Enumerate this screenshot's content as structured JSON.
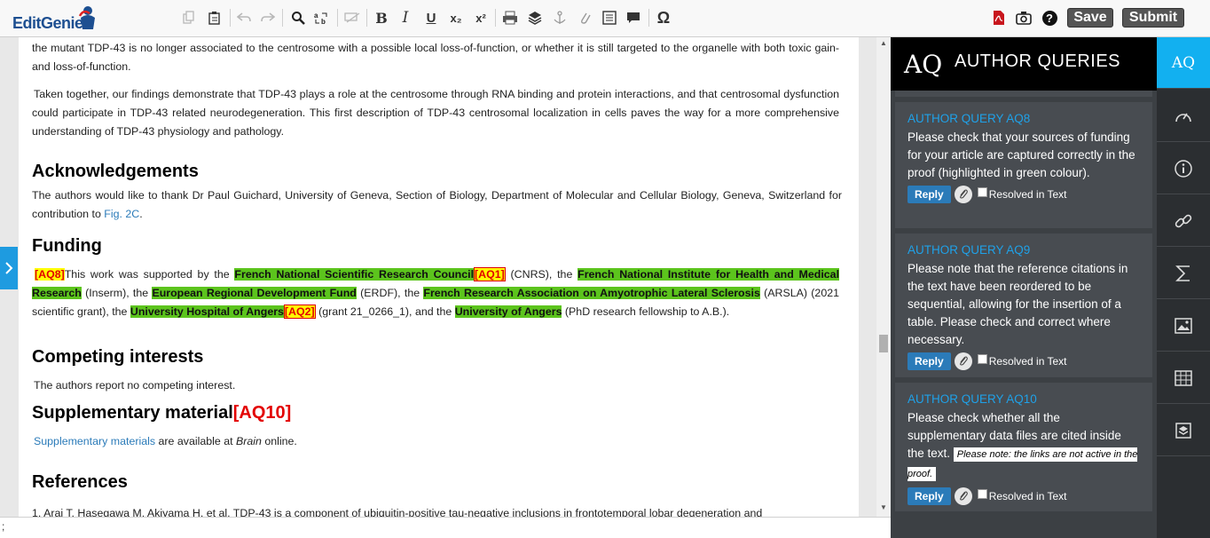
{
  "app": {
    "logo_text": "EditGenie"
  },
  "toolbar": {
    "tools": [
      "copy-icon",
      "paste-icon",
      "undo-icon",
      "redo-icon",
      "search-icon",
      "replace-icon",
      "track-changes-icon",
      "bold-icon",
      "italic-icon",
      "underline-icon",
      "subscript-icon",
      "superscript-icon",
      "print-icon",
      "layers-icon",
      "anchor-icon",
      "link-icon",
      "form-icon",
      "comment-icon",
      "omega-icon"
    ],
    "bold_label": "B",
    "italic_label": "I",
    "underline_label": "U",
    "subscript_label": "x₂",
    "superscript_label": "x²",
    "omega_label": "Ω",
    "save_label": "Save",
    "submit_label": "Submit",
    "help_label": "?"
  },
  "document": {
    "p1": "the mutant TDP-43 is no longer associated to the centrosome with a possible local loss-of-function, or whether it is still targeted to the organelle with both toxic gain- and loss-of-function.",
    "p2": "Taken together, our findings demonstrate that TDP-43 plays a role at the centrosome through RNA binding and protein interactions, and that centrosomal dysfunction could participate in TDP-43 related neurodegeneration. This first description of TDP-43 centrosomal localization in cells paves the way for a more comprehensive understanding of TDP-43 physiology and pathology.",
    "h_ack": "Acknowledgements",
    "ack_text": "The authors would like to thank Dr Paul Guichard, University of Geneva, Section of Biology, Department of Molecular and Cellular Biology, Geneva, Switzerland for contribution to ",
    "ack_link": "Fig. 2C",
    "ack_end": ".",
    "h_funding": "Funding",
    "funding": {
      "aq8": "[AQ8]",
      "t1": "This work was supported by the ",
      "f1": "French National Scientific Research Council",
      "aq1": "[AQ1]",
      "t2": " (CNRS), the ",
      "f2": "French National Institute for Health and Medical Research",
      "t3": " (Inserm), the ",
      "f3": "European Regional Development Fund",
      "t4": " (ERDF), the ",
      "f4": "French Research Association on Amyotrophic Lateral Sclerosis",
      "t5": " (ARSLA) (2021 scientific grant), the ",
      "f5": "University Hospital of Angers",
      "aq2": "[AQ2]",
      "t6": " (grant 21_0266_1), and the ",
      "f6": "University of Angers",
      "t7": " (PhD research fellowship to A.B.)."
    },
    "h_competing": "Competing interests",
    "competing_text": "The authors report no competing interest.",
    "h_supp": "Supplementary material",
    "supp_aq": "[AQ10]",
    "supp_link": "Supplementary materials",
    "supp_text1": " are available at ",
    "supp_journal": "Brain",
    "supp_text2": " online.",
    "h_refs": "References",
    "ref1": "1. Arai T, Hasegawa M, Akiyama H, et al. TDP-43 is a component of ubiquitin-positive tau-negative inclusions in frontotemporal lobar degeneration and",
    "bottom_text": ";"
  },
  "aq_panel": {
    "logo": "AQ",
    "title": "AUTHOR QUERIES",
    "reply_label": "Reply",
    "resolved_label": "Resolved in Text",
    "queries": [
      {
        "title": "AUTHOR QUERY  AQ8",
        "body": "Please check that your sources of funding for your article are captured correctly in the proof (highlighted in green colour)."
      },
      {
        "title": "AUTHOR QUERY  AQ9",
        "body": "Please note that the reference citations in the text have been reordered to be sequential, allowing for the insertion of a table. Please check and correct where necessary."
      },
      {
        "title": "AUTHOR QUERY  AQ10",
        "body": "Please check whether all the supplementary data files are cited inside the text. ",
        "note": "Please note: the links are not active in the proof."
      }
    ]
  },
  "rail": {
    "active_label": "AQ",
    "items": [
      "aq-tab",
      "dashboard-icon",
      "info-icon",
      "link-icon",
      "sigma-icon",
      "image-icon",
      "table-icon",
      "layers-icon"
    ]
  }
}
